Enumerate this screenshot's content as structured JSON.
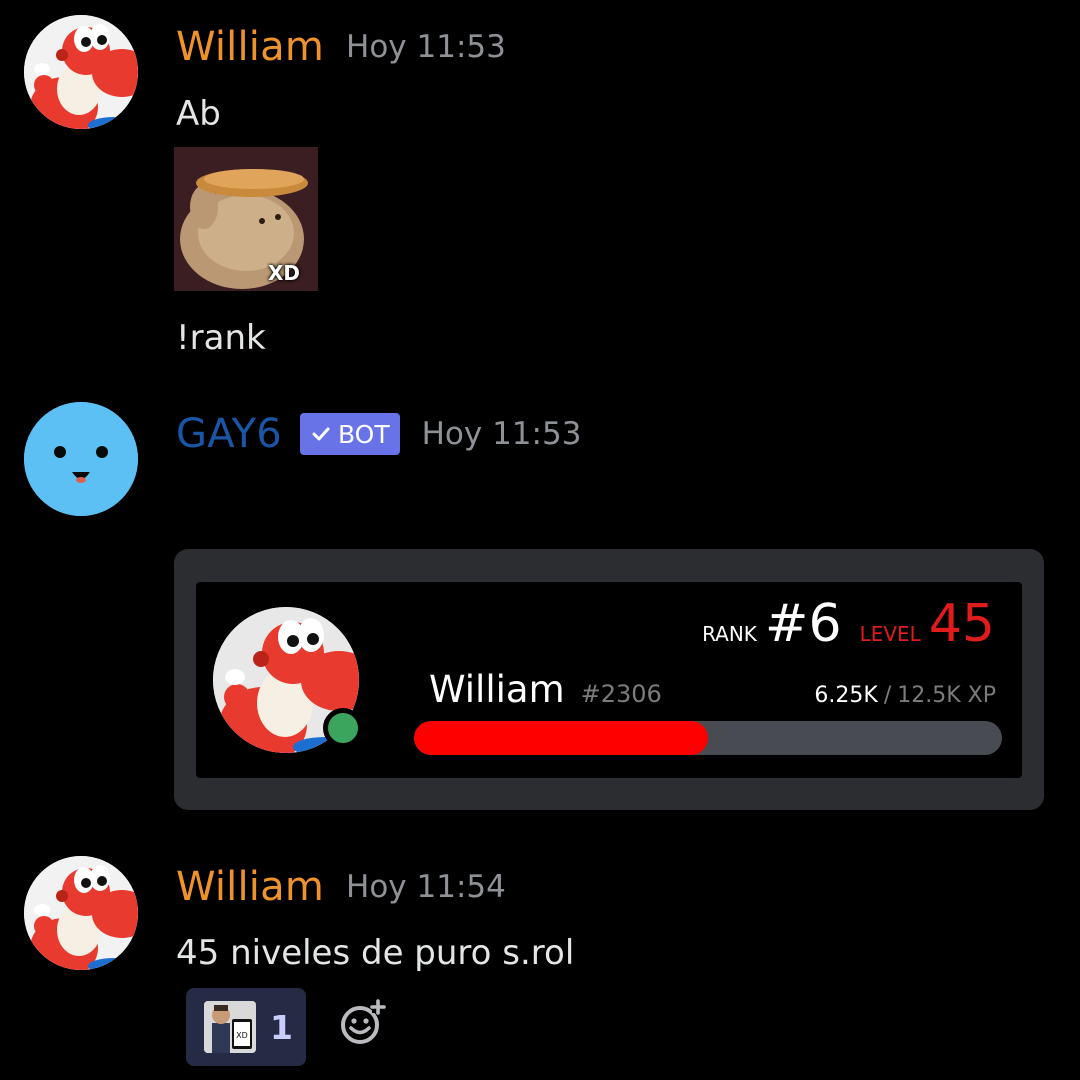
{
  "messages": [
    {
      "author": "William",
      "timestamp": "Hoy 11:53",
      "lines": [
        "Ab",
        "!rank"
      ],
      "attachment": {
        "overlay_text": "XD"
      },
      "avatar_icon": "red-yoshi-avatar"
    },
    {
      "author": "GAY6",
      "bot_tag": "BOT",
      "timestamp": "Hoy 11:53",
      "avatar_icon": "smiley-face-avatar",
      "rank_card": {
        "rank_label": "RANK",
        "rank_value": "#6",
        "level_label": "LEVEL",
        "level_value": "45",
        "username": "William",
        "discriminator": "#2306",
        "xp_current": "6.25K",
        "xp_separator": "/",
        "xp_max": "12.5K XP",
        "progress_fraction": 0.5,
        "status": "online"
      }
    },
    {
      "author": "William",
      "timestamp": "Hoy 11:54",
      "text": "45 niveles de puro s.rol",
      "avatar_icon": "red-yoshi-avatar",
      "reactions": [
        {
          "emoji": "xd-phone-man-emoji",
          "count": "1"
        }
      ]
    }
  ],
  "colors": {
    "background": "#000000",
    "username": "#f0922a",
    "bot_name": "#1a56a8",
    "bot_tag": "#6873e8",
    "level": "#e01b1b",
    "progress_fill": "#ff0000",
    "progress_track": "#484b51",
    "status_online": "#3ba55d"
  }
}
